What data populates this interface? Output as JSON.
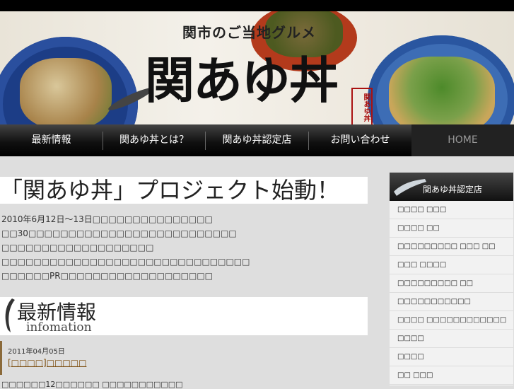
{
  "banner": {
    "subtitle": "関市のご当地グルメ",
    "title": "関あゆ丼",
    "stamp": "関あゆ丼"
  },
  "nav": {
    "items": [
      "最新情報",
      "関あゆ丼とは？",
      "関あゆ丼認定店",
      "お問い合わせ"
    ],
    "home": "HOME"
  },
  "main": {
    "headline": "「関あゆ丼」プロジェクト始動！",
    "paragraph": [
      "2010年6月12日～13日□□□□□□□□□□□□□□□",
      "□□30□□□□□□□□□□□□□□□□□□□□□□□□□□",
      "□□□□□□□□□□□□□□□□□□□",
      "□□□□□□□□□□□□□□□□□□□□□□□□□□□□□□□",
      "□□□□□□PR□□□□□□□□□□□□□□□□□□□"
    ],
    "section_title": "最新情報",
    "section_subtitle": "infomation",
    "news": {
      "date": "2011年04月05日",
      "title": "[□□□□]□□□□□"
    },
    "bottom_text": "□□□□□□12□□□□□□ □□□□□□□□□□□"
  },
  "sidebar": {
    "title": "関あゆ丼認定店",
    "items": [
      "□□□□ □□□",
      "□□□□ □□",
      "□□□□□□□□□ □□□ □□",
      "□□□ □□□□",
      "□□□□□□□□□ □□",
      "□□□□□□□□□□□",
      "□□□□ □□□□□□□□□□□□",
      "□□□□",
      "□□□□",
      "□□ □□□"
    ]
  }
}
